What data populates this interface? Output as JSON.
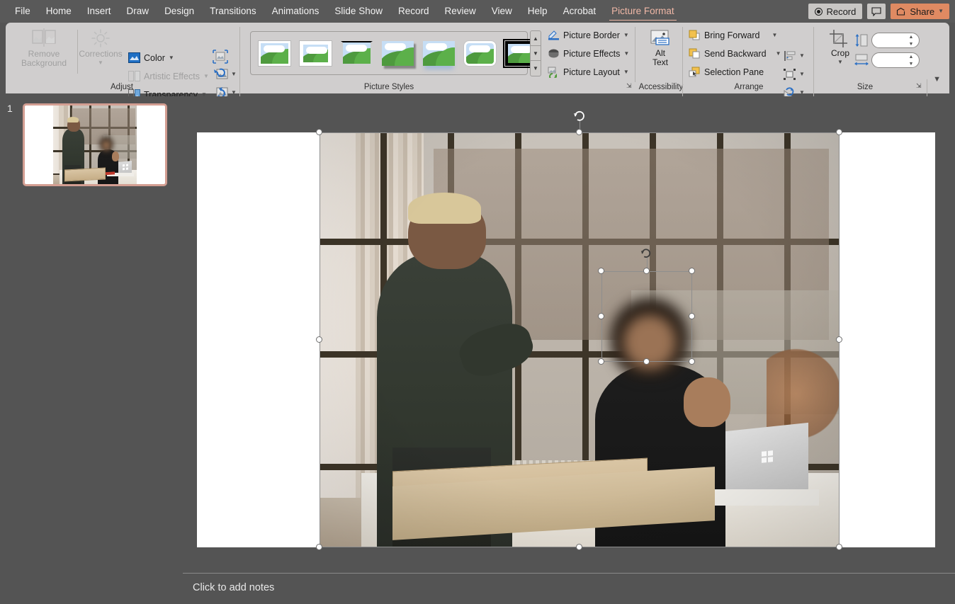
{
  "app": {
    "accent_color": "#efb7a6",
    "share_color": "#e08a62",
    "ribbon_bg": "#d0cece",
    "workspace_bg": "#545454"
  },
  "menu": {
    "items": [
      {
        "label": "File",
        "active": false
      },
      {
        "label": "Home",
        "active": false
      },
      {
        "label": "Insert",
        "active": false
      },
      {
        "label": "Draw",
        "active": false
      },
      {
        "label": "Design",
        "active": false
      },
      {
        "label": "Transitions",
        "active": false
      },
      {
        "label": "Animations",
        "active": false
      },
      {
        "label": "Slide Show",
        "active": false
      },
      {
        "label": "Record",
        "active": false
      },
      {
        "label": "Review",
        "active": false
      },
      {
        "label": "View",
        "active": false
      },
      {
        "label": "Help",
        "active": false
      },
      {
        "label": "Acrobat",
        "active": false
      },
      {
        "label": "Picture Format",
        "active": true
      }
    ],
    "record_label": "Record",
    "share_label": "Share",
    "comment_icon": "comment-icon"
  },
  "ribbon": {
    "groups": {
      "adjust": {
        "label": "Adjust",
        "remove_background": "Remove\nBackground",
        "remove_background_line1": "Remove",
        "remove_background_line2": "Background",
        "corrections": "Corrections",
        "color": "Color",
        "artistic_effects": "Artistic Effects",
        "transparency": "Transparency",
        "compress_icon": "compress-pictures-icon",
        "change_picture_icon": "change-picture-icon",
        "reset_picture_icon": "reset-picture-icon"
      },
      "picture_styles": {
        "label": "Picture Styles",
        "thumbnails": [
          {
            "name": "simple-frame-white",
            "selected": false
          },
          {
            "name": "beveled-matte-white",
            "selected": false
          },
          {
            "name": "metal-frame",
            "selected": false
          },
          {
            "name": "drop-shadow-rectangle",
            "selected": false
          },
          {
            "name": "reflected-rounded-rectangle",
            "selected": false
          },
          {
            "name": "soft-edge-rectangle",
            "selected": false
          },
          {
            "name": "thick-matte-black",
            "selected": true
          }
        ],
        "scroll_up": "scroll-up-icon",
        "scroll_down": "scroll-down-icon",
        "more": "more-styles-icon",
        "picture_border": "Picture Border",
        "picture_effects": "Picture Effects",
        "picture_layout": "Picture Layout"
      },
      "accessibility": {
        "label": "Accessibility",
        "alt_text_line1": "Alt",
        "alt_text_line2": "Text"
      },
      "arrange": {
        "label": "Arrange",
        "bring_forward": "Bring Forward",
        "send_backward": "Send Backward",
        "selection_pane": "Selection Pane",
        "align_icon": "align-objects-icon",
        "group_icon": "group-objects-icon",
        "rotate_icon": "rotate-objects-icon"
      },
      "size": {
        "label": "Size",
        "crop": "Crop",
        "height_value": "",
        "width_value": "",
        "height_icon": "shape-height-icon",
        "width_icon": "shape-width-icon",
        "crop_icon": "crop-icon"
      }
    },
    "collapse_icon": "collapse-ribbon-icon",
    "dialog_launcher": "dialog-launcher-icon"
  },
  "slides": {
    "panel_name": "slide-thumbnail-panel",
    "items": [
      {
        "number": "1",
        "selected": true
      }
    ]
  },
  "canvas": {
    "slide_name": "slide-1",
    "selected_picture": {
      "name": "meeting-photo",
      "handles": 8,
      "rotation_handle": true
    },
    "selected_shape": {
      "name": "face-blur-shape",
      "handles": 8,
      "rotation_handle": true
    }
  },
  "notes": {
    "placeholder": "Click to add notes"
  }
}
